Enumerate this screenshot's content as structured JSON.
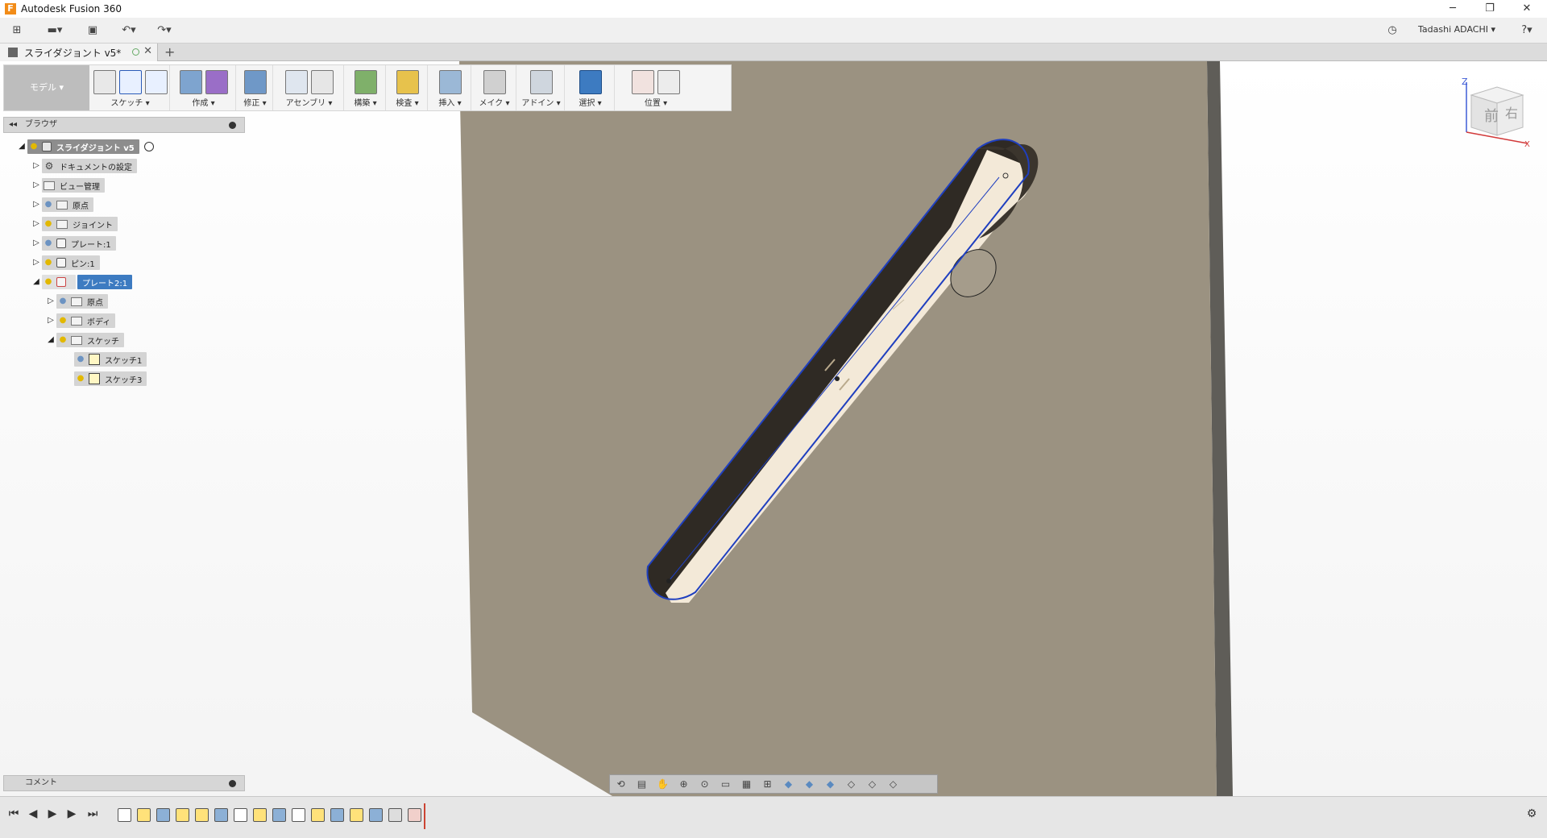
{
  "app": {
    "title": "Autodesk Fusion 360",
    "logo": "F"
  },
  "window_controls": [
    "─",
    "❐",
    "✕"
  ],
  "quick_access": {
    "grid": "⊞",
    "file": "▬▾",
    "save": "▣",
    "undo": "↶▾",
    "redo": "↷▾"
  },
  "user": {
    "name": "Tadashi ADACHI ▾",
    "history": "◷",
    "help": "?▾"
  },
  "document_tab": {
    "title": "スライダジョント v5*",
    "close": "✕",
    "new": "+"
  },
  "ribbon": {
    "mode": "モデル ▾",
    "groups": [
      {
        "label": "スケッチ ▾"
      },
      {
        "label": "作成 ▾"
      },
      {
        "label": "修正 ▾"
      },
      {
        "label": "アセンブリ ▾"
      },
      {
        "label": "構築 ▾"
      },
      {
        "label": "検査 ▾"
      },
      {
        "label": "挿入 ▾"
      },
      {
        "label": "メイク ▾"
      },
      {
        "label": "アドイン ▾"
      },
      {
        "label": "選択 ▾"
      },
      {
        "label": "位置 ▾"
      }
    ]
  },
  "browser": {
    "title": "ブラウザ",
    "collapse": "◂◂",
    "items": [
      {
        "label": "スライダジョント v5"
      },
      {
        "label": "ドキュメントの設定"
      },
      {
        "label": "ビュー管理"
      },
      {
        "label": "原点"
      },
      {
        "label": "ジョイント"
      },
      {
        "label": "プレート:1"
      },
      {
        "label": "ピン:1"
      },
      {
        "label": "プレート2:1"
      },
      {
        "label": "原点"
      },
      {
        "label": "ボディ"
      },
      {
        "label": "スケッチ"
      },
      {
        "label": "スケッチ1"
      },
      {
        "label": "スケッチ3"
      }
    ]
  },
  "comments": {
    "title": "コメント"
  },
  "viewcube": {
    "front": "前",
    "right": "右",
    "z": "Z",
    "x": "X"
  },
  "colors": {
    "plate": "#9b9281",
    "plate_edge": "#5f5d58",
    "slot": "#f3e9d8",
    "selection": "#1f3fbf",
    "accent": "#3d7bc1"
  }
}
